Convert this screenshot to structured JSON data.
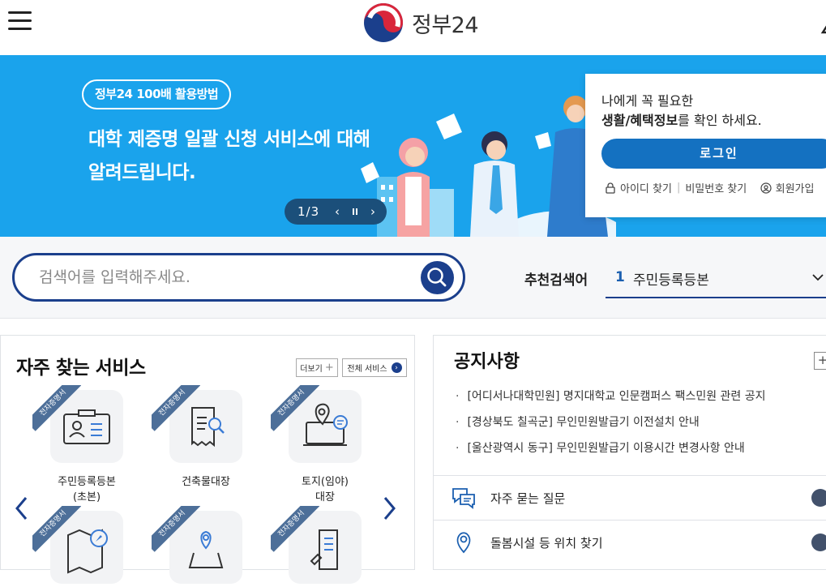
{
  "header": {
    "logo_text": "정부24",
    "menu_icon": "hamburger-menu-icon"
  },
  "banner": {
    "pill": "정부24 100배 활용방법",
    "title_line1": "대학 제증명 일괄 신청 서비스에 대해",
    "title_line2": "알려드립니다.",
    "pager": "1/3",
    "prev": "‹",
    "pause": "⏸",
    "next": "›",
    "bg_color": "#1aa3ec"
  },
  "login": {
    "msg_line1": "나에게 꼭 필요한",
    "msg_bold": "생활/혜택정보",
    "msg_line2_rest": "를 확인 하세요.",
    "button": "로그인",
    "find_id": "아이디 찾기",
    "find_pw": "비밀번호 찾기",
    "signup": "회원가입"
  },
  "search": {
    "placeholder": "검색어를 입력해주세요.",
    "rec_label": "추천검색어",
    "rec_rank": "1",
    "rec_term": "주민등록등본"
  },
  "services": {
    "title": "자주 찾는 서비스",
    "more": "더보기",
    "all": "전체 서비스",
    "ribbon": "전자증명서",
    "items": [
      {
        "label": "주민등록등본\n(초본)",
        "line1": "주민등록등본",
        "line2": "(초본)"
      },
      {
        "label": "건축물대장",
        "line1": "건축물대장",
        "line2": ""
      },
      {
        "label": "토지(임야)\n대장",
        "line1": "토지(임야)",
        "line2": "대장"
      }
    ]
  },
  "notices": {
    "title": "공지사항",
    "items": [
      "[어디서나대학민원] 명지대학교 인문캠퍼스 팩스민원 관련 공지",
      "[경상북도 칠곡군] 무인민원발급기 이전설치 안내",
      "[울산광역시 동구] 무인민원발급기 이용시간 변경사항 안내"
    ],
    "quick": [
      {
        "label": "자주 묻는 질문"
      },
      {
        "label": "돌봄시설 등 위치 찾기"
      }
    ]
  }
}
